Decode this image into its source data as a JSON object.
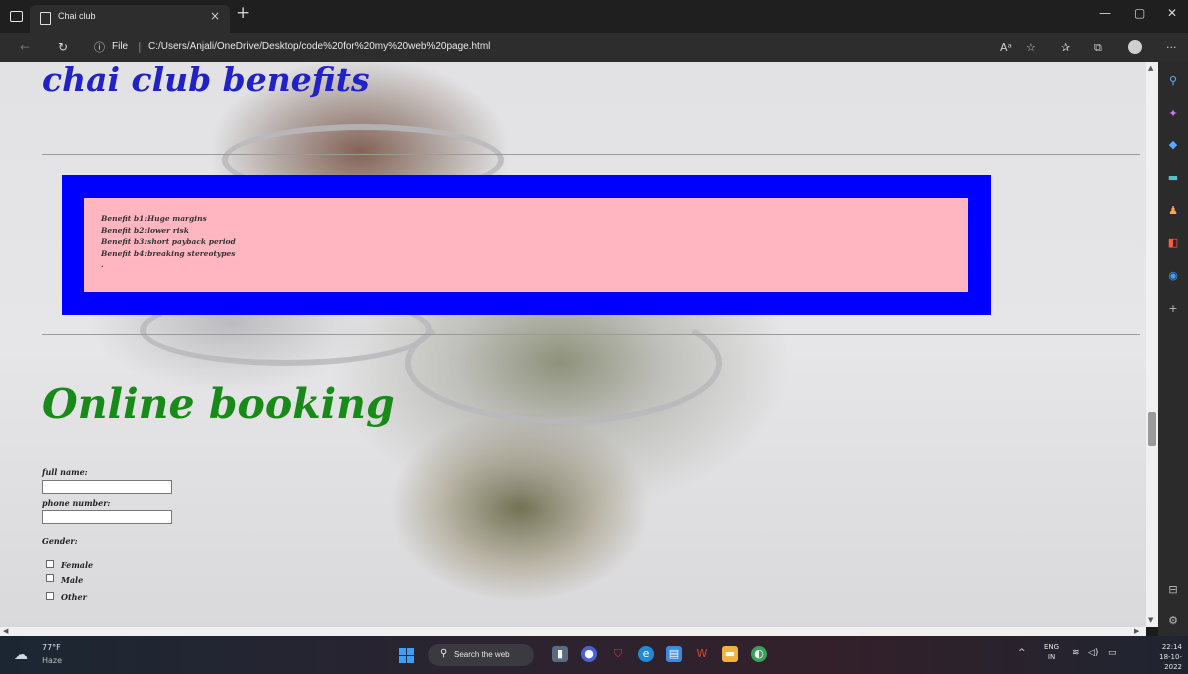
{
  "browser": {
    "tab_title": "Chai club",
    "tab_close": "×",
    "new_tab": "+",
    "url_info_icon": "ⓘ",
    "url_scheme": "File",
    "url_separator": "|",
    "url": "C:/Users/Anjali/OneDrive/Desktop/code%20for%20my%20web%20page.html",
    "window_controls": [
      "—",
      "▢",
      "✕"
    ],
    "toolbar_icons": [
      "read-aloud-icon",
      "favorites-add-icon",
      "favorites-icon",
      "collections-icon",
      "profile-icon",
      "more-icon"
    ],
    "more_label": "···"
  },
  "page": {
    "benefits_heading": "chai club benefits",
    "benefits": [
      "Benefit b1:Huge margins",
      "Benefit b2:lower risk",
      "Benefit b3:short payback period",
      "Benefit b4:breaking stereotypes",
      "."
    ],
    "booking_heading": "Online booking",
    "form": {
      "full_name_label": "full name:",
      "full_name_value": "",
      "phone_label": "phone number:",
      "phone_value": "",
      "gender_label": "Gender:",
      "gender_options": [
        "Female",
        "Male",
        "Other"
      ]
    },
    "colors": {
      "benefits_heading": "#2121c8",
      "booking_heading": "#178a17",
      "benefit_border": "#0000ff",
      "benefit_fill": "#ffb6c1"
    }
  },
  "sidebar_icons": [
    "search-icon",
    "sparkle-icon",
    "tag-icon",
    "toolbox-icon",
    "games-icon",
    "office-icon",
    "outlook-icon",
    "add-icon",
    "split-screen-icon",
    "settings-icon"
  ],
  "taskbar": {
    "weather_temp": "77°F",
    "weather_desc": "Haze",
    "search_placeholder": "Search the web",
    "apps": [
      "task-view-icon",
      "chat-icon",
      "mcafee-icon",
      "edge-icon",
      "store-icon",
      "office-icon",
      "file-explorer-icon",
      "chrome-icon"
    ],
    "language_line1": "ENG",
    "language_line2": "IN",
    "time": "22:14",
    "date": "18-10-2022"
  }
}
